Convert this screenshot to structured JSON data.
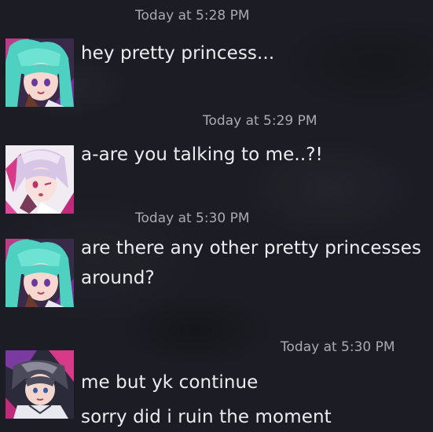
{
  "messages": [
    {
      "timestamp": "Today at 5:28 PM",
      "avatar": "teal-hair-anime-avatar",
      "lines": [
        "hey pretty princess..."
      ]
    },
    {
      "timestamp": "Today at 5:29 PM",
      "avatar": "pink-hair-anime-avatar",
      "lines": [
        "a-are you talking to me..?!"
      ]
    },
    {
      "timestamp": "Today at 5:30 PM",
      "avatar": "teal-hair-anime-avatar",
      "lines": [
        "are there any other pretty princesses",
        "around?"
      ]
    },
    {
      "timestamp": "Today at 5:30 PM",
      "avatar": "dark-hair-anime-avatar",
      "lines": [
        "me but yk continue",
        "sorry did i ruin the moment"
      ]
    }
  ],
  "colors": {
    "background": "#1c1d24",
    "timestamp": "#a9abb4",
    "message_text": "#ecedf1"
  }
}
